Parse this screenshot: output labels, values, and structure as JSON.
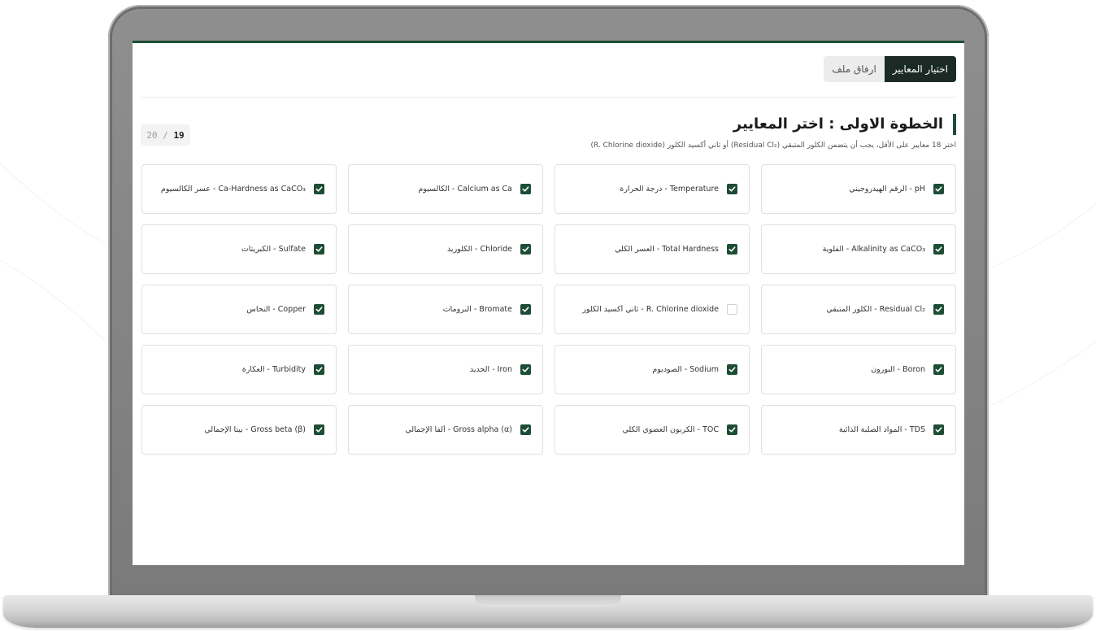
{
  "tabs": {
    "active_label": "اختيار المعايير",
    "inactive_label": "ارفاق ملف"
  },
  "step": {
    "title": "الخطوة الاولى : اختر المعايير",
    "hint": "اختر 18 معايير على الأقل، يجب أن يتضمن الكلور المتبقي (Residual Cl₂) أو ثاني أكسيد الكلور (R. Chlorine dioxide)"
  },
  "counter": {
    "selected": "19",
    "total": "20 /"
  },
  "colors": {
    "accent": "#1e4d36",
    "tab_active": "#1b2a25"
  },
  "parameters": [
    {
      "label": "pH - الرقم الهيدروجيني",
      "checked": true
    },
    {
      "label": "Temperature - درجة الحرارة",
      "checked": true
    },
    {
      "label": "Calcium as Ca - الكالسيوم",
      "checked": true
    },
    {
      "label": "Ca-Hardness as CaCO₃ - عسر الكالسيوم",
      "checked": true
    },
    {
      "label": "Alkalinity as CaCO₃ - القلوية",
      "checked": true
    },
    {
      "label": "Total Hardness - العسر الكلي",
      "checked": true
    },
    {
      "label": "Chloride - الكلوريد",
      "checked": true
    },
    {
      "label": "Sulfate - الكبريتات",
      "checked": true
    },
    {
      "label": "Residual Cl₂ - الكلور المتبقي",
      "checked": true
    },
    {
      "label": "R. Chlorine dioxide - ثاني أكسيد الكلور",
      "checked": false
    },
    {
      "label": "Bromate - البرومات",
      "checked": true
    },
    {
      "label": "Copper - النحاس",
      "checked": true
    },
    {
      "label": "Boron - البورون",
      "checked": true
    },
    {
      "label": "Sodium - الصوديوم",
      "checked": true
    },
    {
      "label": "Iron - الحديد",
      "checked": true
    },
    {
      "label": "Turbidity - العكارة",
      "checked": true
    },
    {
      "label": "TDS - المواد الصلبة الذائبة",
      "checked": true
    },
    {
      "label": "TOC - الكربون العضوي الكلي",
      "checked": true
    },
    {
      "label": "Gross alpha (α) - ألفا الإجمالي",
      "checked": true
    },
    {
      "label": "Gross beta (β) - بيتا الإجمالي",
      "checked": true
    }
  ]
}
